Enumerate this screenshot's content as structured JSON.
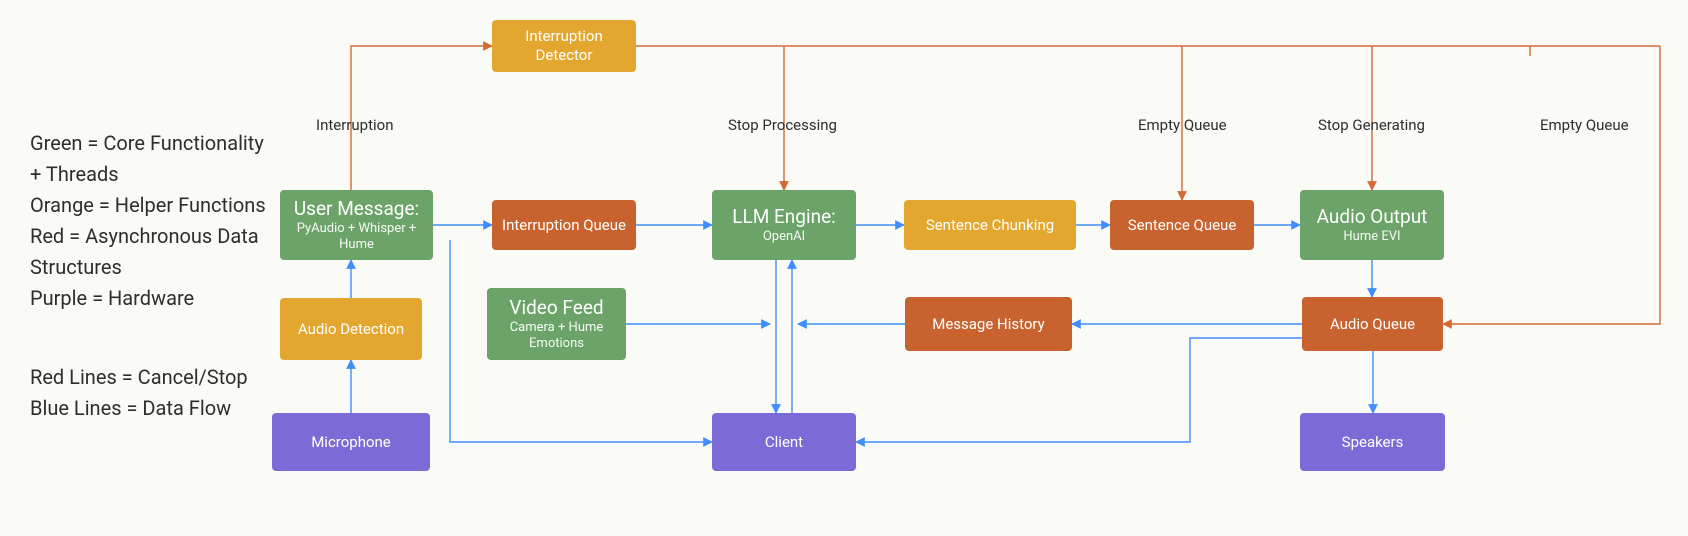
{
  "legend": {
    "l1": "Green = Core Functionality + Threads",
    "l2": "Orange = Helper Functions",
    "l3": "Red = Asynchronous Data Structures",
    "l4": "Purple = Hardware",
    "l5": "Red Lines = Cancel/Stop",
    "l6": "Blue Lines = Data Flow"
  },
  "boxes": {
    "interruption_detector": "Interruption Detector",
    "user_message_title": "User Message:",
    "user_message_sub": "PyAudio + Whisper + Hume",
    "interruption_queue": "Interruption Queue",
    "llm_title": "LLM Engine:",
    "llm_sub": "OpenAI",
    "sentence_chunking": "Sentence Chunking",
    "sentence_queue": "Sentence Queue",
    "audio_output_title": "Audio Output",
    "audio_output_sub": "Hume EVI",
    "audio_detection": "Audio Detection",
    "video_feed_title": "Video Feed",
    "video_feed_sub": "Camera + Hume Emotions",
    "message_history": "Message History",
    "audio_queue": "Audio  Queue",
    "microphone": "Microphone",
    "client": "Client",
    "speakers": "Speakers"
  },
  "edge_labels": {
    "interruption": "Interruption",
    "stop_processing": "Stop Processing",
    "empty_queue1": "Empty Queue",
    "stop_generating": "Stop Generating",
    "empty_queue2": "Empty Queue"
  },
  "colors": {
    "green": "#6ba368",
    "orange": "#e3a72f",
    "red": "#c8632f",
    "purple": "#7c6bd6",
    "blue_line": "#3f8efc",
    "red_line": "#d26b36"
  }
}
